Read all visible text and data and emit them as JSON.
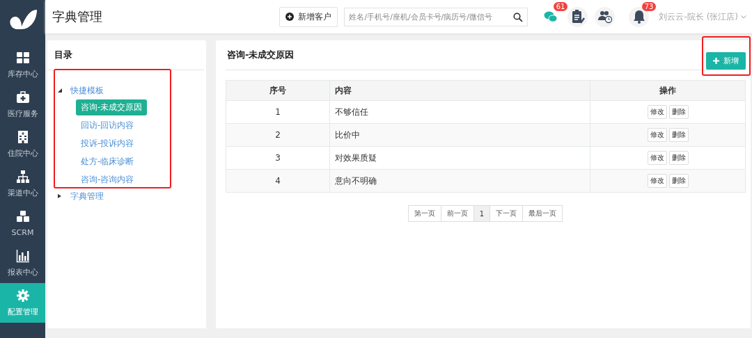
{
  "sidebar": {
    "items": [
      {
        "kind": "grid",
        "label": "库存中心",
        "selected": false
      },
      {
        "kind": "medkit",
        "label": "医疗服务",
        "selected": false
      },
      {
        "kind": "hospital",
        "label": "住院中心",
        "selected": false
      },
      {
        "kind": "sitemap",
        "label": "渠道中心",
        "selected": false
      },
      {
        "kind": "cubes",
        "label": "SCRM",
        "selected": false
      },
      {
        "kind": "chart",
        "label": "报表中心",
        "selected": false
      },
      {
        "kind": "gear",
        "label": "配置管理",
        "selected": true
      }
    ]
  },
  "header": {
    "title": "字典管理",
    "add_customer_button": "新增客户",
    "search": {
      "placeholder": "姓名/手机号/座机/会员卡号/病历号/微信号"
    },
    "icons": [
      {
        "kind": "wechat",
        "badge": "61"
      },
      {
        "kind": "clipboard"
      },
      {
        "kind": "group"
      },
      {
        "kind": "bell",
        "badge": "73"
      }
    ],
    "user": "刘云云-院长 (张江店)"
  },
  "catalog": {
    "title": "目录",
    "highlighted": true,
    "tree": [
      {
        "label": "快捷模板",
        "expanded": true,
        "children": [
          {
            "label": "咨询-未成交原因",
            "selected": true
          },
          {
            "label": "回访-回访内容",
            "selected": false
          },
          {
            "label": "投诉-投诉内容",
            "selected": false
          },
          {
            "label": "处方-临床诊断",
            "selected": false
          },
          {
            "label": "咨询-咨询内容",
            "selected": false
          }
        ]
      },
      {
        "label": "字典管理",
        "expanded": false
      }
    ]
  },
  "detail": {
    "title": "咨询-未成交原因",
    "add_button": {
      "label": "新增",
      "highlighted": true
    },
    "table": {
      "columns": [
        "序号",
        "内容",
        "操作"
      ],
      "rows": [
        {
          "cells": [
            "1",
            "不够信任"
          ],
          "actions": [
            "修改",
            "删除"
          ]
        },
        {
          "cells": [
            "2",
            "比价中"
          ],
          "actions": [
            "修改",
            "删除"
          ]
        },
        {
          "cells": [
            "3",
            "对效果质疑"
          ],
          "actions": [
            "修改",
            "删除"
          ]
        },
        {
          "cells": [
            "4",
            "意向不明确"
          ],
          "actions": [
            "修改",
            "删除"
          ]
        }
      ]
    },
    "pagination": [
      {
        "label": "第一页",
        "selected": false
      },
      {
        "label": "前一页",
        "selected": false
      },
      {
        "label": "1",
        "selected": true
      },
      {
        "label": "下一页",
        "selected": false
      },
      {
        "label": "最后一页",
        "selected": false
      }
    ]
  }
}
